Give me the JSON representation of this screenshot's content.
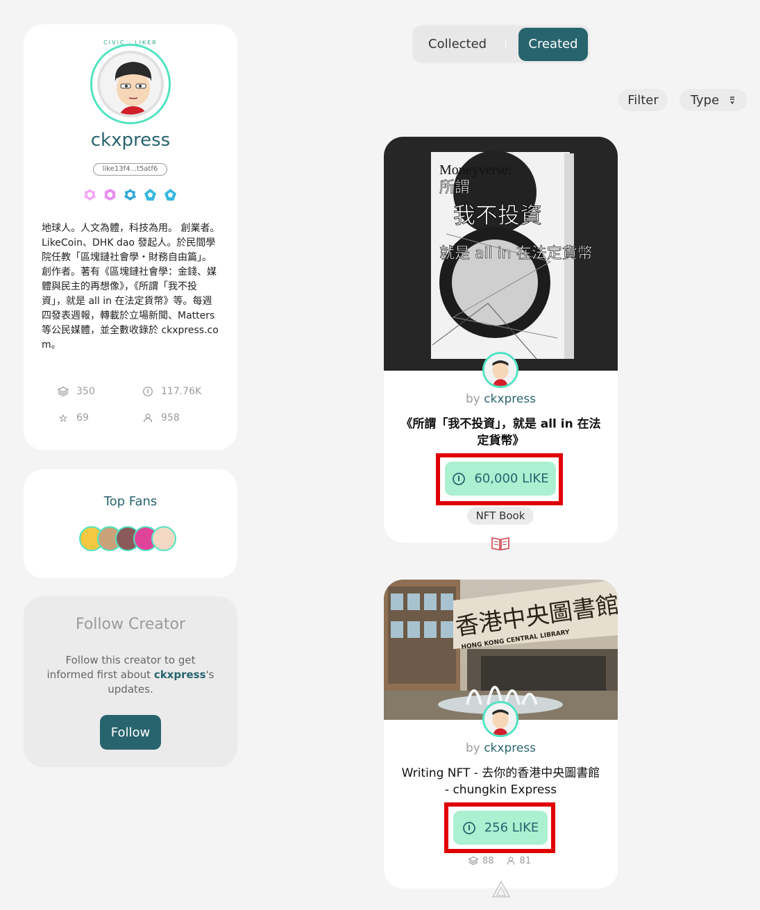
{
  "profile": {
    "civic_label": "CIVIC · LIKER",
    "username": "ckxpress",
    "address": "like13f4...t5atf6",
    "bio": "地球人。人文為體，科技為用。 創業者。LikeCoin、DHK dao 發起人。於民間學院任教「區塊鏈社會學・財務自由篇」。 創作者。著有《區塊鏈社會學：金錢、媒體與民主的再想像》，《所謂「我不投資」，就是 all in 在法定貨幣》等。每週四發表週報，轉載於立場新聞、Matters 等公民媒體，並全數收錄於 ckxpress.com。",
    "stats": {
      "nfts": "350",
      "likes": "117.76K",
      "stars": "69",
      "followers": "958"
    },
    "badge_colors": [
      "#e88ef0",
      "#e88ef0",
      "#35b8e0",
      "#35b8e0",
      "#35b8e0"
    ]
  },
  "top_fans": {
    "title": "Top Fans"
  },
  "follow_creator": {
    "title": "Follow Creator",
    "desc_prefix": "Follow this creator to get informed first about ",
    "desc_name": "ckxpress",
    "desc_suffix": "'s updates.",
    "button": "Follow"
  },
  "tabs": {
    "collected": "Collected",
    "created": "Created"
  },
  "toolbar": {
    "filter": "Filter",
    "type": "Type"
  },
  "nfts": [
    {
      "by": "by",
      "creator": "ckxpress",
      "title": "《所謂「我不投資」，就是 all in 在法定貨幣》",
      "like": "60,000 LIKE",
      "tag": "NFT Book",
      "cover_title": "Moneyverse:",
      "cover_sub1": "所謂",
      "cover_sub2": "我不投資",
      "cover_sub3": "就是 all in 在法定貨幣"
    },
    {
      "by": "by",
      "creator": "ckxpress",
      "title": "Writing NFT - 去你的香港中央圖書館 - chungkin Express",
      "like": "256 LIKE",
      "collectors": "88",
      "owners": "81",
      "sign_text": "香港中央圖書館",
      "sign_en": "HONG KONG CENTRAL LIBRARY"
    }
  ]
}
